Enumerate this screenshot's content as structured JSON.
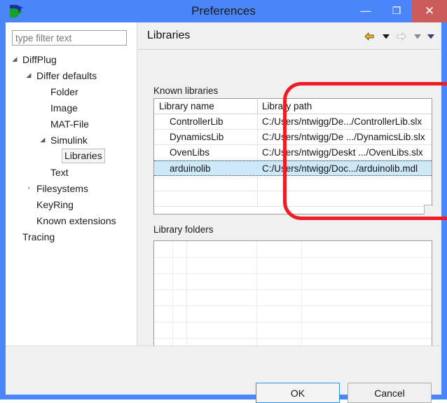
{
  "window": {
    "title": "Preferences",
    "app_icon": "diffplug-logo-icon",
    "controls": {
      "minimize": "—",
      "maximize": "❐",
      "close": "✕"
    }
  },
  "sidebar": {
    "filter": {
      "value": "",
      "placeholder": "type filter text"
    },
    "items": [
      {
        "label": "DiffPlug",
        "indent": 0,
        "twisty": "expanded",
        "selected": false
      },
      {
        "label": "Differ defaults",
        "indent": 1,
        "twisty": "expanded",
        "selected": false
      },
      {
        "label": "Folder",
        "indent": 2,
        "twisty": "none",
        "selected": false
      },
      {
        "label": "Image",
        "indent": 2,
        "twisty": "none",
        "selected": false
      },
      {
        "label": "MAT-File",
        "indent": 2,
        "twisty": "none",
        "selected": false
      },
      {
        "label": "Simulink",
        "indent": 2,
        "twisty": "expanded",
        "selected": false
      },
      {
        "label": "Libraries",
        "indent": 3,
        "twisty": "none",
        "selected": true
      },
      {
        "label": "Text",
        "indent": 2,
        "twisty": "none",
        "selected": false
      },
      {
        "label": "Filesystems",
        "indent": 1,
        "twisty": "collapsed",
        "selected": false
      },
      {
        "label": "KeyRing",
        "indent": 1,
        "twisty": "none",
        "selected": false
      },
      {
        "label": "Known extensions",
        "indent": 1,
        "twisty": "none",
        "selected": false
      },
      {
        "label": "Tracing",
        "indent": 0,
        "twisty": "none",
        "selected": false
      }
    ]
  },
  "content": {
    "title": "Libraries",
    "toolbar": [
      {
        "name": "back-arrow-icon",
        "kind": "arrow-left",
        "color": "#e8b23a",
        "enabled": true
      },
      {
        "name": "back-dropdown-icon",
        "kind": "caret-down",
        "color": "#1b1b1b",
        "enabled": true
      },
      {
        "name": "forward-arrow-icon",
        "kind": "arrow-right",
        "color": "#c9c9c9",
        "enabled": false
      },
      {
        "name": "forward-dropdown-icon",
        "kind": "caret-down",
        "color": "#8a8a8a",
        "enabled": false
      },
      {
        "name": "view-menu-dropdown-icon",
        "kind": "caret-down",
        "color": "#54307c",
        "enabled": true
      }
    ],
    "known_libraries": {
      "group_label": "Known libraries",
      "columns": [
        "Library name",
        "Library path"
      ],
      "rows": [
        {
          "name": "ControllerLib",
          "path": "C:/Users/ntwigg/De.../ControllerLib.slx",
          "selected": false
        },
        {
          "name": "DynamicsLib",
          "path": "C:/Users/ntwigg/De .../DynamicsLib.slx",
          "selected": false
        },
        {
          "name": "OvenLibs",
          "path": "C:/Users/ntwigg/Deskt .../OvenLibs.slx",
          "selected": false
        },
        {
          "name": "arduinolib",
          "path": "C:/Users/ntwigg/Doc.../arduinolib.mdl",
          "selected": true
        }
      ],
      "empty_rows": 2,
      "highlight_color": "#cde8f7",
      "annotation_color": "#ee1c25"
    },
    "library_folders": {
      "group_label": "Library folders",
      "rows": []
    }
  },
  "buttons": {
    "ok": "OK",
    "cancel": "Cancel"
  }
}
